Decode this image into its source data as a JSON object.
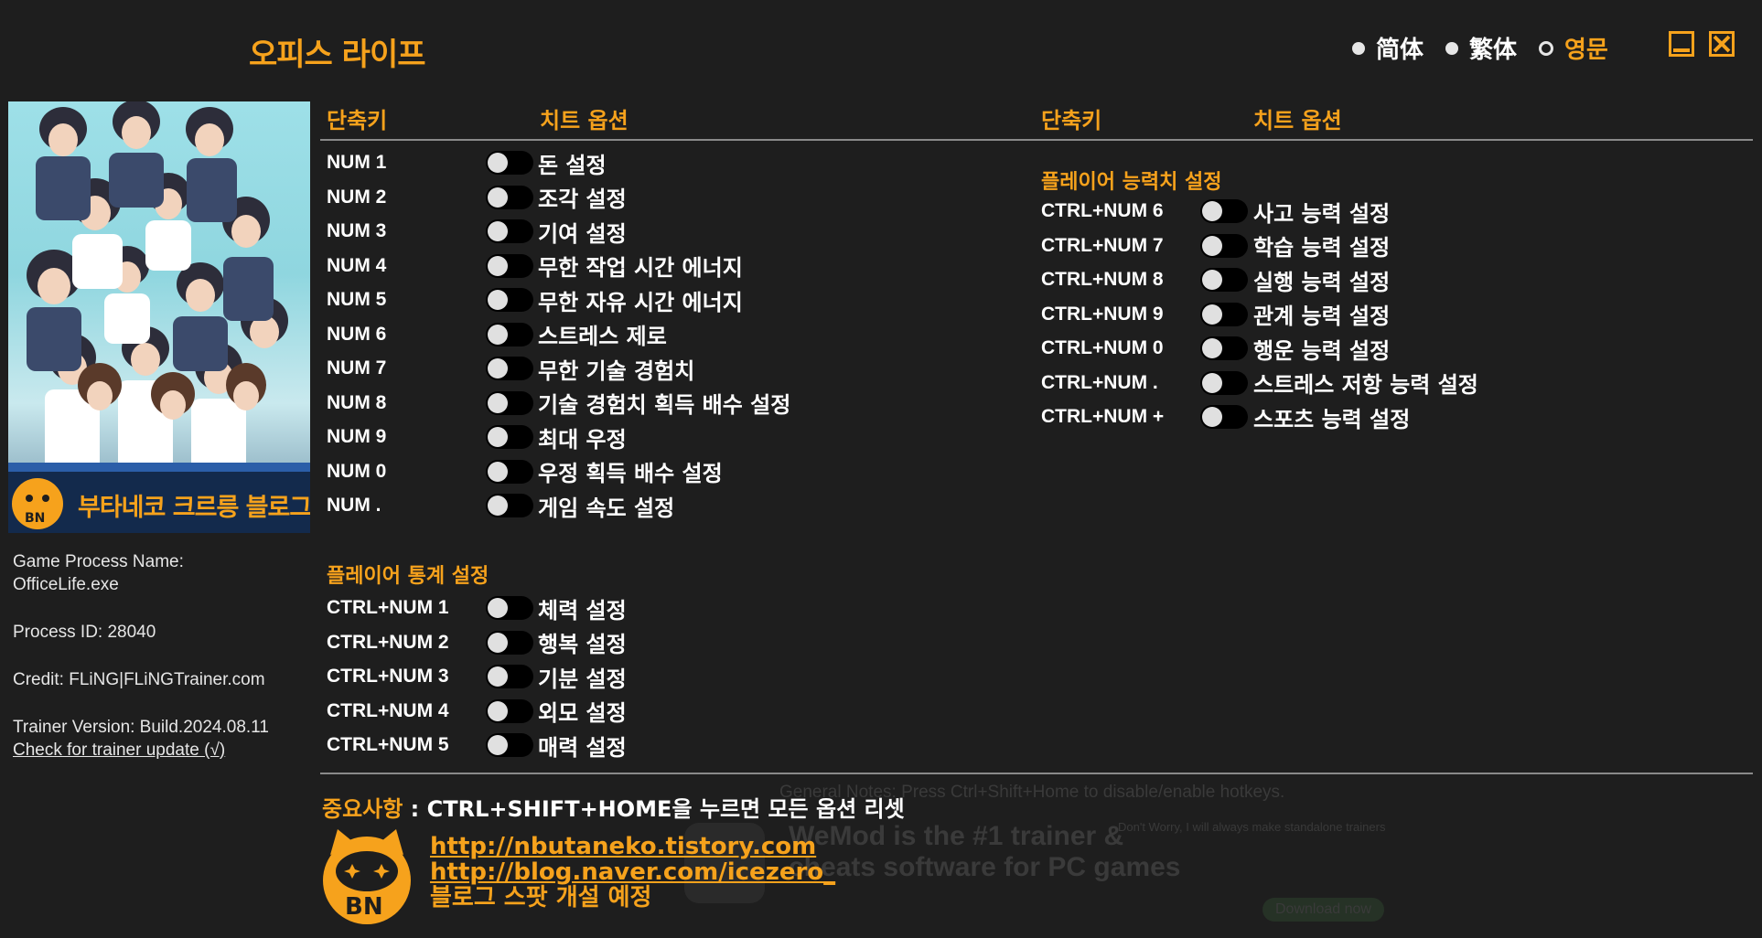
{
  "app": {
    "title": "오피스 라이프",
    "languages": [
      {
        "label": "简体",
        "selected": false
      },
      {
        "label": "繁体",
        "selected": false
      },
      {
        "label": "영문",
        "selected": true
      }
    ],
    "accent_color": "#f6a21c"
  },
  "sidebar": {
    "cover_banner": "부타네코 크르릉 블로그",
    "cover_logo_text": "BN",
    "process_name_label": "Game Process Name:",
    "process_name_value": "OfficeLife.exe",
    "process_id": "Process ID: 28040",
    "credit": "Credit: FLiNG|FLiNGTrainer.com",
    "version": "Trainer Version: Build.2024.08.11",
    "update_link": "Check for trainer update (√)"
  },
  "headers": {
    "hotkey": "단축키",
    "option": "치트 옵션"
  },
  "left_options": [
    {
      "key": "NUM 1",
      "label": "돈 설정"
    },
    {
      "key": "NUM 2",
      "label": "조각 설정"
    },
    {
      "key": "NUM 3",
      "label": "기여 설정"
    },
    {
      "key": "NUM 4",
      "label": "무한 작업 시간 에너지"
    },
    {
      "key": "NUM 5",
      "label": "무한 자유 시간 에너지"
    },
    {
      "key": "NUM 6",
      "label": "스트레스 제로"
    },
    {
      "key": "NUM 7",
      "label": "무한 기술 경험치"
    },
    {
      "key": "NUM 8",
      "label": "기술 경험치 획득 배수 설정"
    },
    {
      "key": "NUM 9",
      "label": "최대 우정"
    },
    {
      "key": "NUM 0",
      "label": "우정 획득 배수 설정"
    },
    {
      "key": "NUM .",
      "label": "게임 속도 설정"
    }
  ],
  "stats_section": {
    "title": "플레이어 통계 설정",
    "options": [
      {
        "key": "CTRL+NUM 1",
        "label": "체력 설정"
      },
      {
        "key": "CTRL+NUM 2",
        "label": "행복 설정"
      },
      {
        "key": "CTRL+NUM 3",
        "label": "기분 설정"
      },
      {
        "key": "CTRL+NUM 4",
        "label": "외모 설정"
      },
      {
        "key": "CTRL+NUM 5",
        "label": "매력 설정"
      }
    ]
  },
  "ability_section": {
    "title": "플레이어 능력치 설정",
    "options": [
      {
        "key": "CTRL+NUM 6",
        "label": "사고 능력 설정"
      },
      {
        "key": "CTRL+NUM 7",
        "label": "학습 능력 설정"
      },
      {
        "key": "CTRL+NUM 8",
        "label": "실행 능력 설정"
      },
      {
        "key": "CTRL+NUM 9",
        "label": "관계 능력 설정"
      },
      {
        "key": "CTRL+NUM 0",
        "label": "행운 능력 설정"
      },
      {
        "key": "CTRL+NUM .",
        "label": "스트레스 저항 능력 설정"
      },
      {
        "key": "CTRL+NUM +",
        "label": "스포츠 능력 설정"
      }
    ]
  },
  "footer": {
    "notice_label": "중요사항",
    "notice_text": " : CTRL+SHIFT+HOME을 누르면 모든 옵션 리셋",
    "ghost_notes": "General Notes: Press Ctrl+Shift+Home to disable/enable hotkeys.",
    "ghost_ad_line1": "WeMod is the #1 trainer &",
    "ghost_ad_line2": "cheats software for PC games",
    "ghost_ad_side": "Don't Worry, I will always make standalone trainers",
    "ghost_download": "Download now",
    "logo_text": "BN",
    "link1": "http://nbutaneko.tistory.com",
    "link2": "http://blog.naver.com/icezero_",
    "link3": "블로그 스팟 개설 예정"
  }
}
